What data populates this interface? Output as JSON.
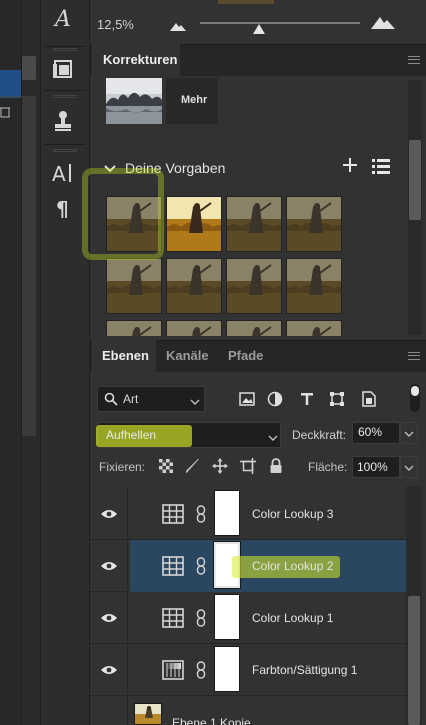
{
  "toolbar": {
    "zoom_value": "12,5%",
    "zoom_level_fraction": 0.37
  },
  "korrekturen": {
    "title": "Korrekturen",
    "mehr_label": "Mehr",
    "section_label": "Deine Vorgaben",
    "preset_count_visible": 12
  },
  "layers_panel": {
    "tabs": [
      {
        "label": "Ebenen",
        "active": true
      },
      {
        "label": "Kanäle",
        "active": false
      },
      {
        "label": "Pfade",
        "active": false
      }
    ],
    "filter_label": "Art",
    "blend_mode": "Aufhellen",
    "opacity_label": "Deckkraft:",
    "opacity_value": "60%",
    "lock_label": "Fixieren:",
    "fill_label": "Fläche:",
    "fill_value": "100%",
    "layers": [
      {
        "name": "Color Lookup 3",
        "type": "color-lookup",
        "selected": false
      },
      {
        "name": "Color Lookup 2",
        "type": "color-lookup",
        "selected": true
      },
      {
        "name": "Color Lookup 1",
        "type": "color-lookup",
        "selected": false
      },
      {
        "name": "Farbton/Sättigung 1",
        "type": "hue-saturation",
        "selected": false
      },
      {
        "name": "Ebene 1 Kopie",
        "type": "pixel",
        "selected": false
      }
    ]
  },
  "colors": {
    "selection": "#2a4661",
    "highlighter": "#d8ec28",
    "panel_bg": "#323232",
    "header_bg": "#262626"
  }
}
